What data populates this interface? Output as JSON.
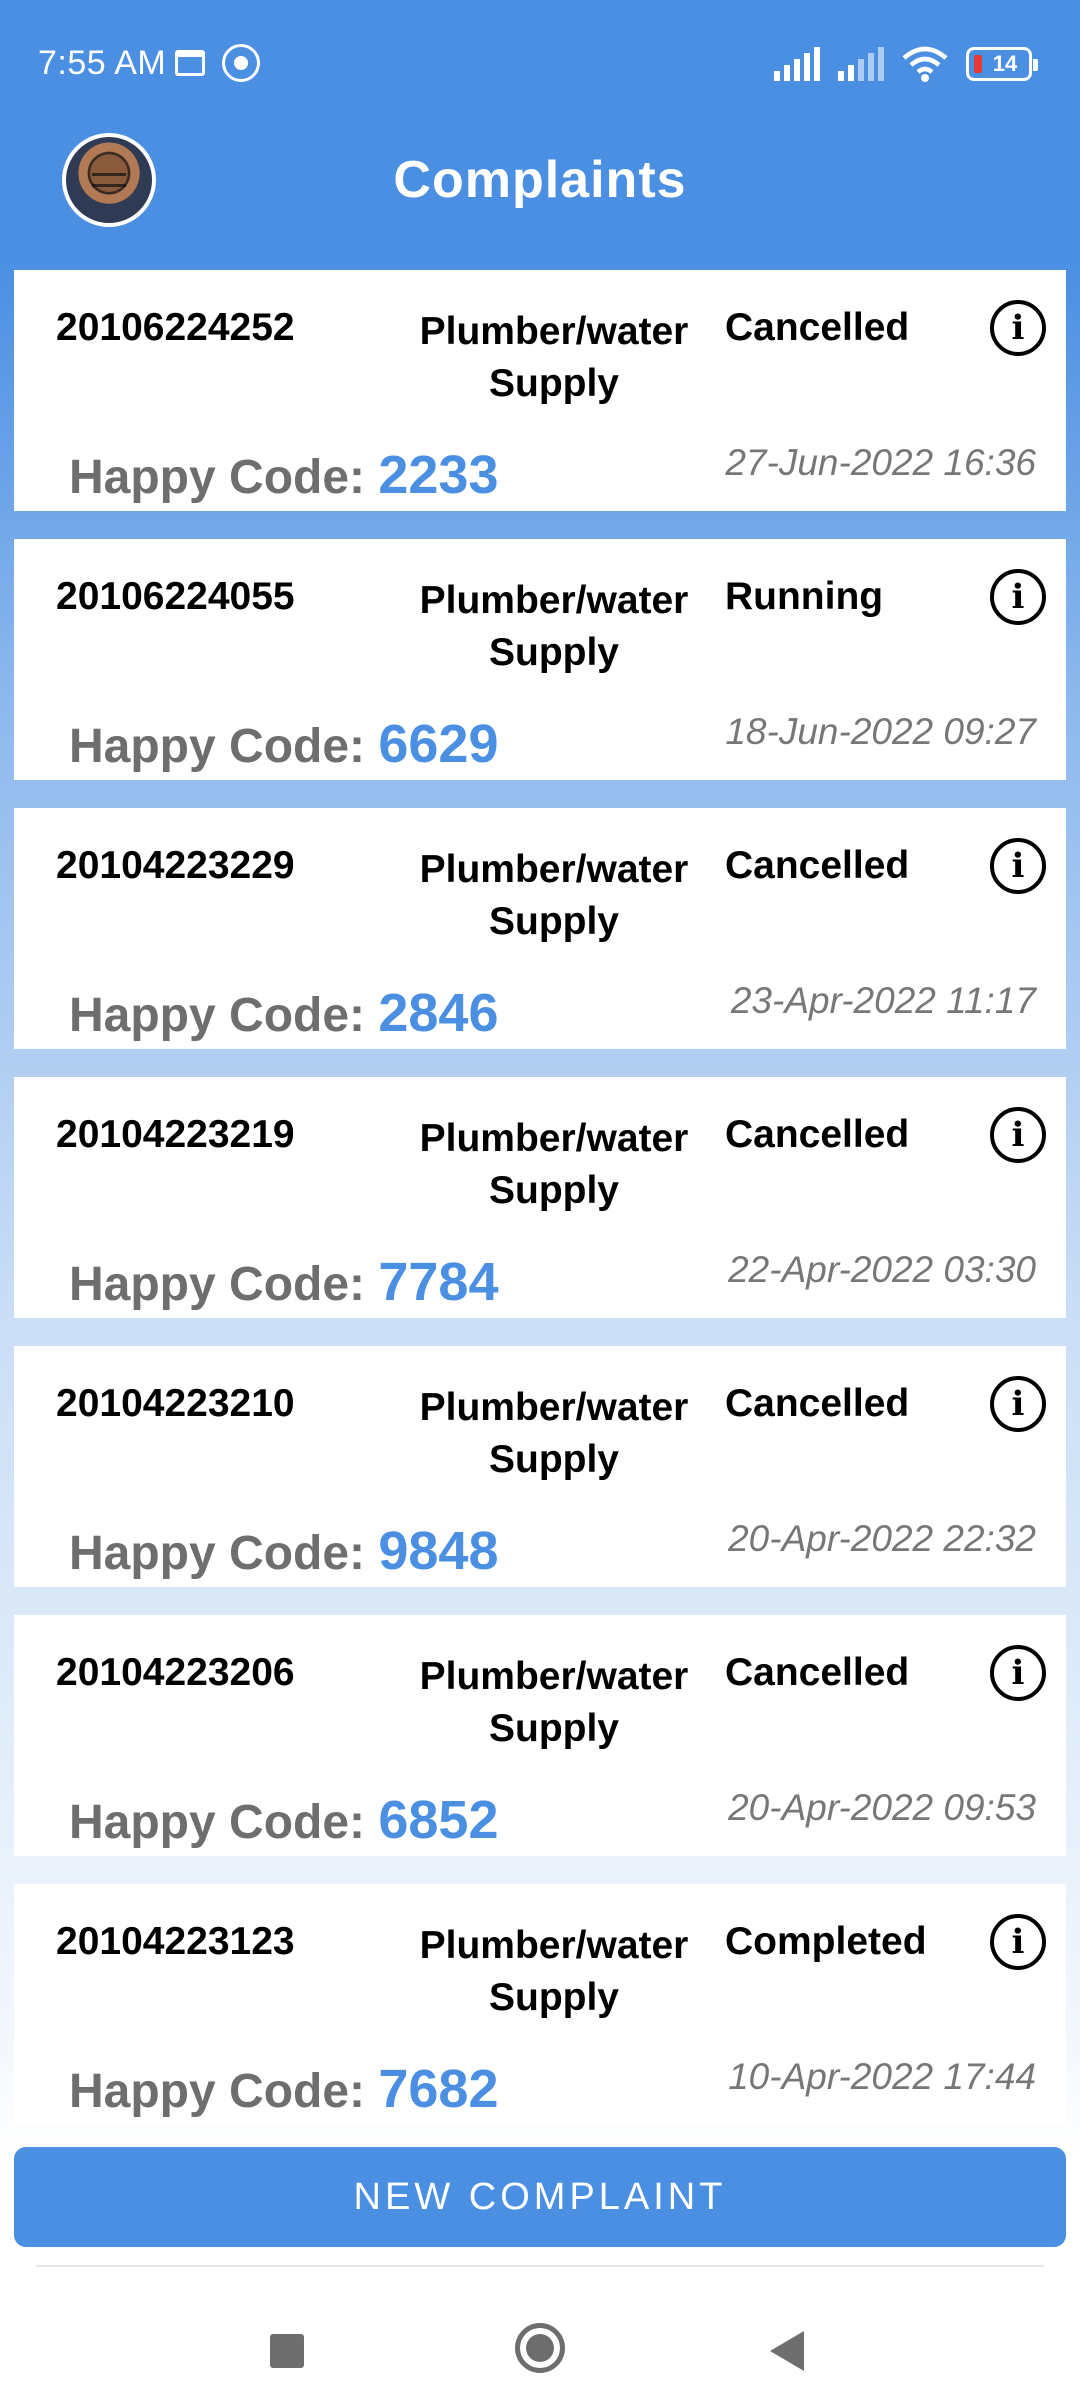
{
  "status_bar": {
    "time": "7:55 AM",
    "battery": "14",
    "icons": [
      "calendar-icon",
      "app-icon",
      "signal-icon",
      "signal-icon",
      "wifi-icon",
      "battery-icon"
    ]
  },
  "header": {
    "title": "Complaints",
    "avatar": "user-avatar"
  },
  "complaints": [
    {
      "id": "20106224252",
      "type": "Plumber/water Supply",
      "status": "Cancelled",
      "happy_label": "Happy Code:",
      "happy_code": "2233",
      "date": "27-Jun-2022 16:36"
    },
    {
      "id": "20106224055",
      "type": "Plumber/water Supply",
      "status": "Running",
      "happy_label": "Happy Code:",
      "happy_code": "6629",
      "date": "18-Jun-2022 09:27"
    },
    {
      "id": "20104223229",
      "type": "Plumber/water Supply",
      "status": "Cancelled",
      "happy_label": "Happy Code:",
      "happy_code": "2846",
      "date": "23-Apr-2022 11:17"
    },
    {
      "id": "20104223219",
      "type": "Plumber/water Supply",
      "status": "Cancelled",
      "happy_label": "Happy Code:",
      "happy_code": "7784",
      "date": "22-Apr-2022 03:30"
    },
    {
      "id": "20104223210",
      "type": "Plumber/water Supply",
      "status": "Cancelled",
      "happy_label": "Happy Code:",
      "happy_code": "9848",
      "date": "20-Apr-2022 22:32"
    },
    {
      "id": "20104223206",
      "type": "Plumber/water Supply",
      "status": "Cancelled",
      "happy_label": "Happy Code:",
      "happy_code": "6852",
      "date": "20-Apr-2022 09:53"
    },
    {
      "id": "20104223123",
      "type": "Plumber/water Supply",
      "status": "Completed",
      "happy_label": "Happy Code:",
      "happy_code": "7682",
      "date": "10-Apr-2022 17:44"
    }
  ],
  "actions": {
    "new_complaint": "NEW COMPLAINT"
  },
  "colors": {
    "primary": "#4A8FE2",
    "code": "#4A8FE2",
    "muted": "#6E6E6E"
  },
  "navbar": {
    "icons": [
      "recents-square-icon",
      "home-circle-icon",
      "back-triangle-icon"
    ]
  }
}
